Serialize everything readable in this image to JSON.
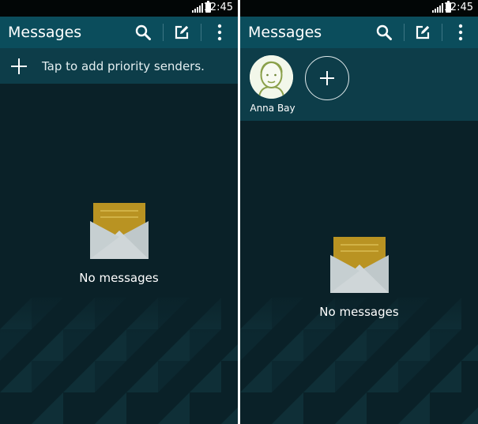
{
  "left_screen": {
    "status_bar": {
      "time": "12:45"
    },
    "action_bar": {
      "title": "Messages",
      "icons": [
        "search-icon",
        "compose-icon",
        "more-options-icon"
      ]
    },
    "priority_senders_prompt": "Tap to add priority senders.",
    "empty_state": {
      "text": "No messages",
      "icon": "envelope-icon"
    }
  },
  "right_screen": {
    "status_bar": {
      "time": "12:45"
    },
    "action_bar": {
      "title": "Messages",
      "icons": [
        "search-icon",
        "compose-icon",
        "more-options-icon"
      ]
    },
    "priority_senders": [
      {
        "name": "Anna Bay",
        "icon": "avatar"
      }
    ],
    "add_priority_sender_icon": "plus-icon",
    "empty_state": {
      "text": "No messages",
      "icon": "envelope-icon"
    }
  },
  "colors": {
    "status_bar": "#020606",
    "action_bar": "#0b4d5c",
    "priority_bar": "#0d3d49",
    "background": "#0a2128",
    "envelope_letter": "#b99322",
    "envelope_body": "#bfc8ca"
  }
}
